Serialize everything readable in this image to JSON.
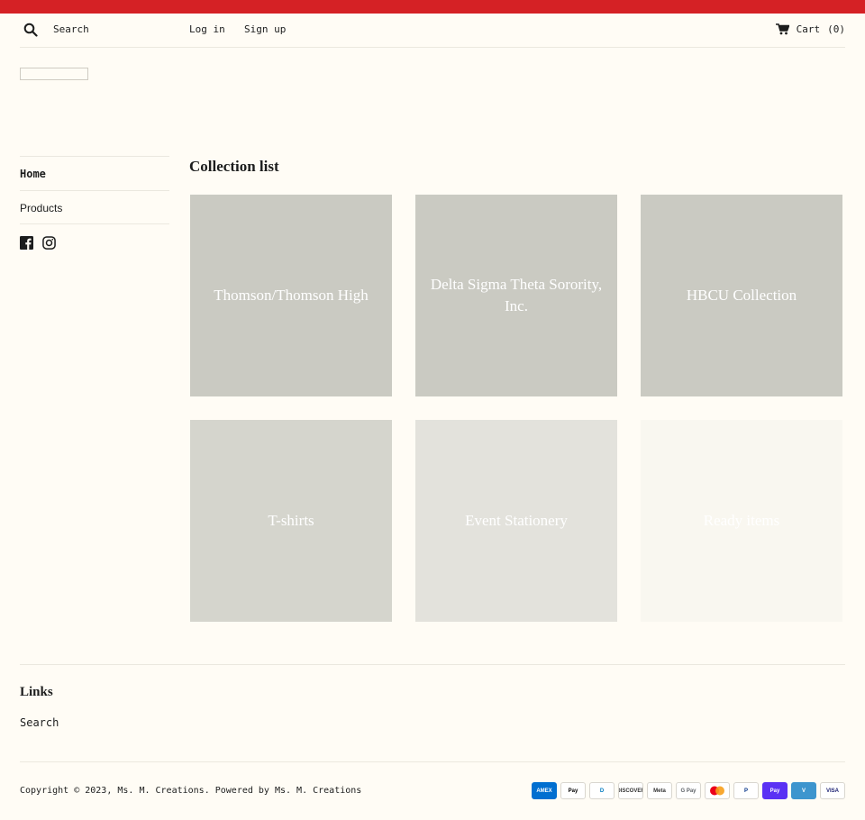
{
  "header": {
    "search_label": "Search",
    "login_label": "Log in",
    "signup_label": "Sign up",
    "cart_label": "Cart",
    "cart_count": "(0)"
  },
  "sidebar": {
    "items": [
      {
        "label": "Home"
      },
      {
        "label": "Products"
      }
    ]
  },
  "main": {
    "title": "Collection list",
    "collections": [
      {
        "label": "Thomson/Thomson High",
        "color": "#cacac2"
      },
      {
        "label": "Delta Sigma Theta Sorority, Inc.",
        "color": "#cacac2"
      },
      {
        "label": "HBCU Collection",
        "color": "#cacac2"
      },
      {
        "label": "T-shirts",
        "color": "#d5d5cd"
      },
      {
        "label": "Event Stationery",
        "color": "#e3e2dc"
      },
      {
        "label": "Ready items",
        "color": "#f9f7f0"
      }
    ]
  },
  "footer": {
    "links_title": "Links",
    "links_search": "Search",
    "copyright": "Copyright © 2023, Ms. M. Creations. Powered by Ms. M. Creations",
    "payments": [
      {
        "name": "AMEX",
        "bg": "#016fd0",
        "fg": "#ffffff"
      },
      {
        "name": "Pay",
        "bg": "#ffffff",
        "fg": "#000000"
      },
      {
        "name": "D",
        "bg": "#ffffff",
        "fg": "#0079be"
      },
      {
        "name": "DISCOVER",
        "bg": "#ffffff",
        "fg": "#333333"
      },
      {
        "name": "Meta",
        "bg": "#ffffff",
        "fg": "#333333"
      },
      {
        "name": "G Pay",
        "bg": "#ffffff",
        "fg": "#5f6368"
      },
      {
        "name": "",
        "bg": "#ffffff",
        "fg": "#333333"
      },
      {
        "name": "P",
        "bg": "#ffffff",
        "fg": "#003087"
      },
      {
        "name": "Pay",
        "bg": "#5a31f4",
        "fg": "#ffffff"
      },
      {
        "name": "V",
        "bg": "#3d95ce",
        "fg": "#ffffff"
      },
      {
        "name": "VISA",
        "bg": "#ffffff",
        "fg": "#1a1f71"
      }
    ]
  },
  "colors": {
    "topbar": "#d52125",
    "background": "#fffcf5",
    "text": "#1c1d1d"
  }
}
